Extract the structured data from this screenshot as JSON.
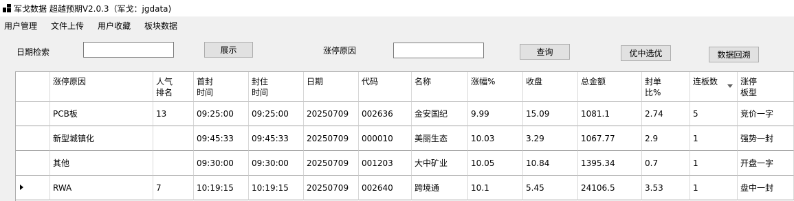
{
  "window": {
    "title": "军戈数据 超越预期V2.0.3（军戈：jgdata)"
  },
  "menu": [
    {
      "label": "用户管理"
    },
    {
      "label": "文件上传"
    },
    {
      "label": "用户收藏"
    },
    {
      "label": "板块数据"
    }
  ],
  "toolbar": {
    "date_label": "日期检索",
    "date_value": "",
    "show_button": "展示",
    "reason_label": "涨停原因",
    "reason_value": "",
    "query_button": "查询",
    "select_button": "优中选优",
    "backtest_button": "数据回溯"
  },
  "table": {
    "headers": [
      "涨停原因",
      "人气排名",
      "首封时间",
      "封住时间",
      "日期",
      "代码",
      "名称",
      "涨幅%",
      "收盘",
      "总金额",
      "封单比%",
      "连板数",
      "涨停板型"
    ],
    "sort_column": "连板数",
    "current_row": 3,
    "rows": [
      [
        "PCB板",
        "13",
        "09:25:00",
        "09:25:00",
        "20250709",
        "002636",
        "金安国纪",
        "9.99",
        "15.09",
        "1081.1",
        "2.74",
        "5",
        "竞价一字"
      ],
      [
        "新型城镇化",
        "",
        "09:45:33",
        "09:45:33",
        "20250709",
        "000010",
        "美丽生态",
        "10.03",
        "3.29",
        "1067.77",
        "2.9",
        "1",
        "强势一封"
      ],
      [
        "其他",
        "",
        "09:30:00",
        "09:30:00",
        "20250709",
        "001203",
        "大中矿业",
        "10.05",
        "10.84",
        "1395.34",
        "0.7",
        "1",
        "开盘一字"
      ],
      [
        "RWA",
        "7",
        "10:19:15",
        "10:19:15",
        "20250709",
        "002640",
        "跨境通",
        "10.1",
        "5.45",
        "24106.5",
        "3.53",
        "1",
        "盘中一封"
      ]
    ]
  }
}
